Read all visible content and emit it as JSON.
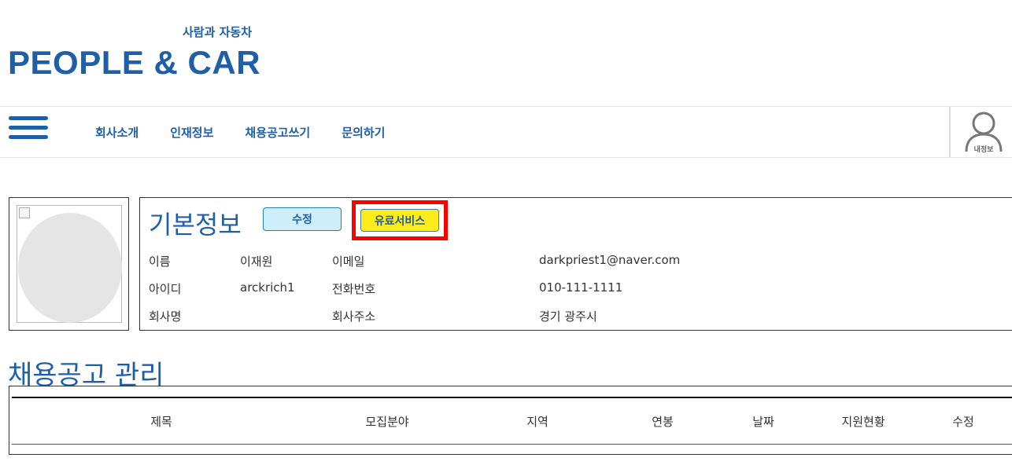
{
  "logo": {
    "subtitle": "사람과 자동차",
    "title": "PEOPLE & CAR"
  },
  "nav": {
    "items": [
      "회사소개",
      "인재정보",
      "채용공고쓰기",
      "문의하기"
    ],
    "user_label": "내정보",
    "icons": {
      "menu": "hamburger-menu-icon",
      "user": "user-profile-icon"
    }
  },
  "profile": {
    "section_title": "기본정보",
    "edit_label": "수정",
    "paid_service_label": "유료서비스",
    "fields": {
      "name_label": "이름",
      "name_value": "이재원",
      "email_label": "이메일",
      "email_value": "darkpriest1@naver.com",
      "id_label": "아이디",
      "id_value": "arckrich1",
      "phone_label": "전화번호",
      "phone_value": "010-111-1111",
      "company_label": "회사명",
      "company_value": "",
      "address_label": "회사주소",
      "address_value": "경기 광주시"
    }
  },
  "jobs": {
    "section_title": "채용공고 관리",
    "columns": [
      "제목",
      "모집분야",
      "지역",
      "연봉",
      "날짜",
      "지원현황",
      "수정"
    ]
  },
  "colors": {
    "brand": "#1f5fa8",
    "edit_button_bg": "#cfeefc",
    "paid_button_bg": "#ffec1a",
    "highlight": "#ff0000"
  }
}
